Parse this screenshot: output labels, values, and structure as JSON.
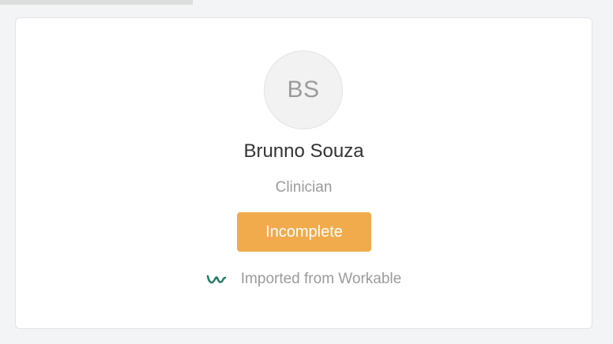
{
  "profile": {
    "initials": "BS",
    "name": "Brunno Souza",
    "role": "Clinician",
    "status": "Incomplete",
    "source_text": "Imported from Workable",
    "source_icon": "workable-logo-icon",
    "colors": {
      "status_badge": "#f1ab4c",
      "workable_icon": "#1f7a63"
    }
  }
}
